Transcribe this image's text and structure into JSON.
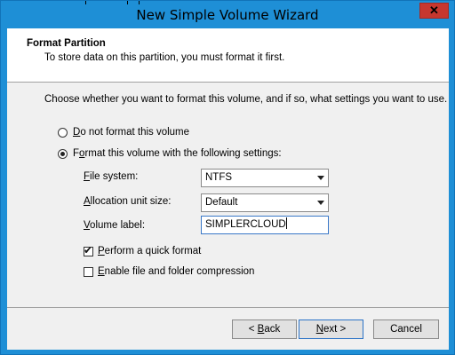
{
  "window": {
    "title": "New Simple Volume Wizard",
    "close_glyph": "✕"
  },
  "header": {
    "title": "Format Partition",
    "subtitle": "To store data on this partition, you must format it first."
  },
  "instruction": "Choose whether you want to format this volume, and if so, what settings you want to use.",
  "options": {
    "no_format": {
      "access_key": "D",
      "label_rest": "o not format this volume",
      "selected": false
    },
    "format": {
      "label_pre": "F",
      "access_key": "o",
      "label_rest": "rmat this volume with the following settings:",
      "selected": true
    }
  },
  "fields": {
    "file_system": {
      "access_key": "F",
      "label_rest": "ile system:",
      "value": "NTFS"
    },
    "allocation_unit": {
      "access_key": "A",
      "label_rest": "llocation unit size:",
      "value": "Default"
    },
    "volume_label": {
      "access_key": "V",
      "label_rest": "olume label:",
      "value": "SIMPLERCLOUD"
    }
  },
  "checkboxes": {
    "quick_format": {
      "access_key": "P",
      "label_rest": "erform a quick format",
      "checked": true,
      "mark": "✔"
    },
    "compression": {
      "access_key": "E",
      "label_rest": "nable file and folder compression",
      "checked": false
    }
  },
  "buttons": {
    "back": {
      "pre": "< ",
      "access_key": "B",
      "rest": "ack"
    },
    "next": {
      "access_key": "N",
      "rest": "ext >"
    },
    "cancel": {
      "label": "Cancel"
    }
  },
  "colors": {
    "titlebar": "#1e8fd6",
    "close": "#c7372f",
    "client": "#f0f0f0"
  }
}
